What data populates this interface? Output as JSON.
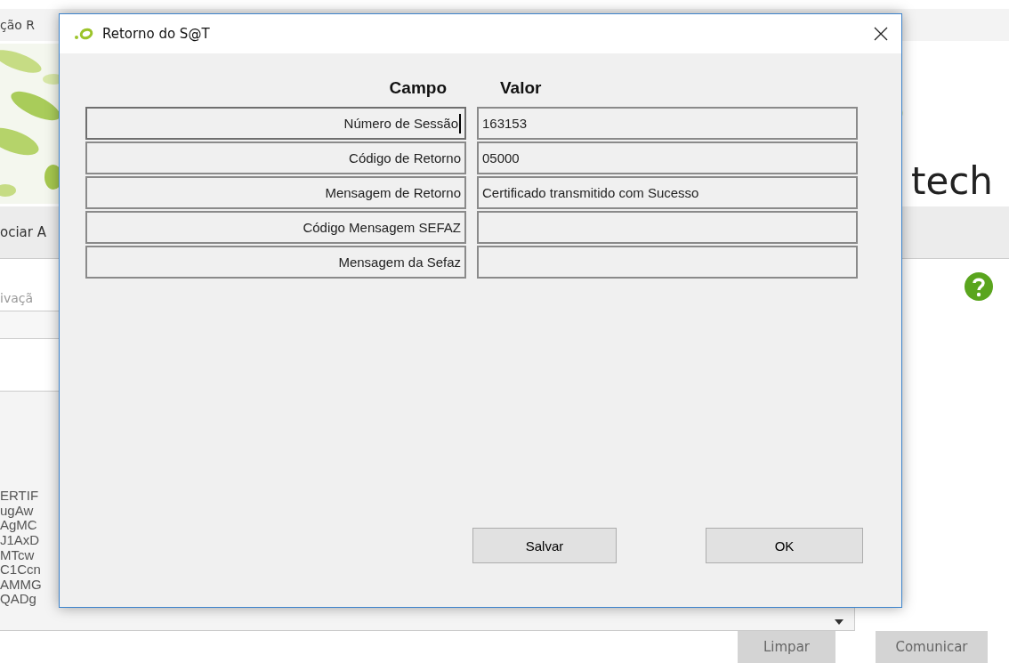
{
  "background_app": {
    "title_fragment": "ção R",
    "logo_text": "tech",
    "tab_fragment": "ociar A",
    "label_fragment": "ivaçã",
    "certificate_lines": [
      "ERTIF",
      "ugAw",
      "AgMC",
      "J1AxD",
      "MTcw",
      "C1Ccn",
      "AMMG",
      "QADg"
    ],
    "buttons": [
      {
        "label": "Limpar",
        "disabled": true
      },
      {
        "label": "Comunicar",
        "disabled": true
      }
    ]
  },
  "dialog": {
    "title": "Retorno do S@T",
    "columns": [
      "Campo",
      "Valor"
    ],
    "rows": [
      {
        "field": "Número de Sessão",
        "value": "163153",
        "focused": true
      },
      {
        "field": "Código de Retorno",
        "value": "05000",
        "focused": false
      },
      {
        "field": "Mensagem de Retorno",
        "value": "Certificado transmitido com Sucesso",
        "focused": false
      },
      {
        "field": "Código Mensagem SEFAZ",
        "focused": false
      },
      {
        "field": "Mensagem da Sefaz",
        "focused": false
      }
    ],
    "buttons": [
      "Salvar",
      "OK"
    ]
  }
}
